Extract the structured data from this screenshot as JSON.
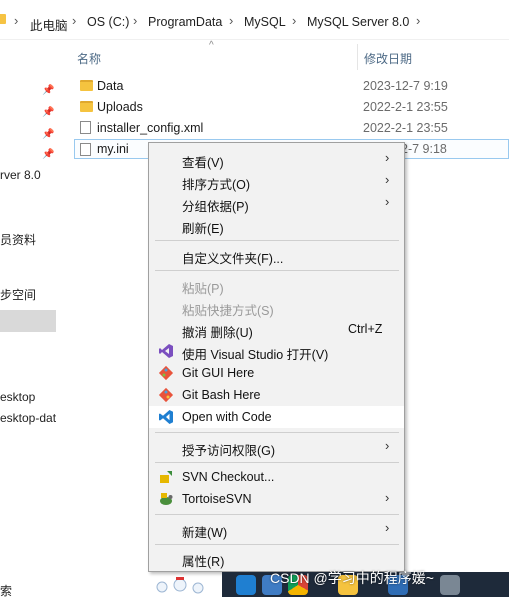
{
  "breadcrumb": [
    "此电脑",
    "OS (C:)",
    "ProgramData",
    "MySQL",
    "MySQL Server 8.0"
  ],
  "nav": {
    "items": [
      "rver 8.0",
      "员资料",
      "步空间",
      "esktop",
      "esktop-dat"
    ]
  },
  "list": {
    "col_name": "名称",
    "col_date": "修改日期",
    "rows": [
      {
        "name": "Data",
        "date": "2023-12-7 9:19",
        "type": "folder"
      },
      {
        "name": "Uploads",
        "date": "2022-2-1 23:55",
        "type": "folder"
      },
      {
        "name": "installer_config.xml",
        "date": "2022-2-1 23:55",
        "type": "file"
      },
      {
        "name": "my.ini",
        "date": "2-7 9:18",
        "type": "file"
      }
    ]
  },
  "menu": {
    "view": "查看(V)",
    "sort": "排序方式(O)",
    "group": "分组依据(P)",
    "refresh": "刷新(E)",
    "customize": "自定义文件夹(F)...",
    "paste": "粘贴(P)",
    "paste_shortcut": "粘贴快捷方式(S)",
    "undo": "撤消 删除(U)",
    "undo_accel": "Ctrl+Z",
    "open_vs": "使用 Visual Studio 打开(V)",
    "git_gui": "Git GUI Here",
    "git_bash": "Git Bash Here",
    "open_code": "Open with Code",
    "grant_access": "授予访问权限(G)",
    "svn_checkout": "SVN Checkout...",
    "tortoise": "TortoiseSVN",
    "new": "新建(W)",
    "properties": "属性(R)"
  },
  "bottom": {
    "search_fragment": "索",
    "watermark": "CSDN @学习中的程序媛~"
  },
  "colors": {
    "vs_purple": "#7b4fbf",
    "vscode_blue": "#1f7fd1",
    "git_red": "#e8533b",
    "svn_yellow": "#e6b800",
    "taskbar": "#1e2a3a"
  }
}
